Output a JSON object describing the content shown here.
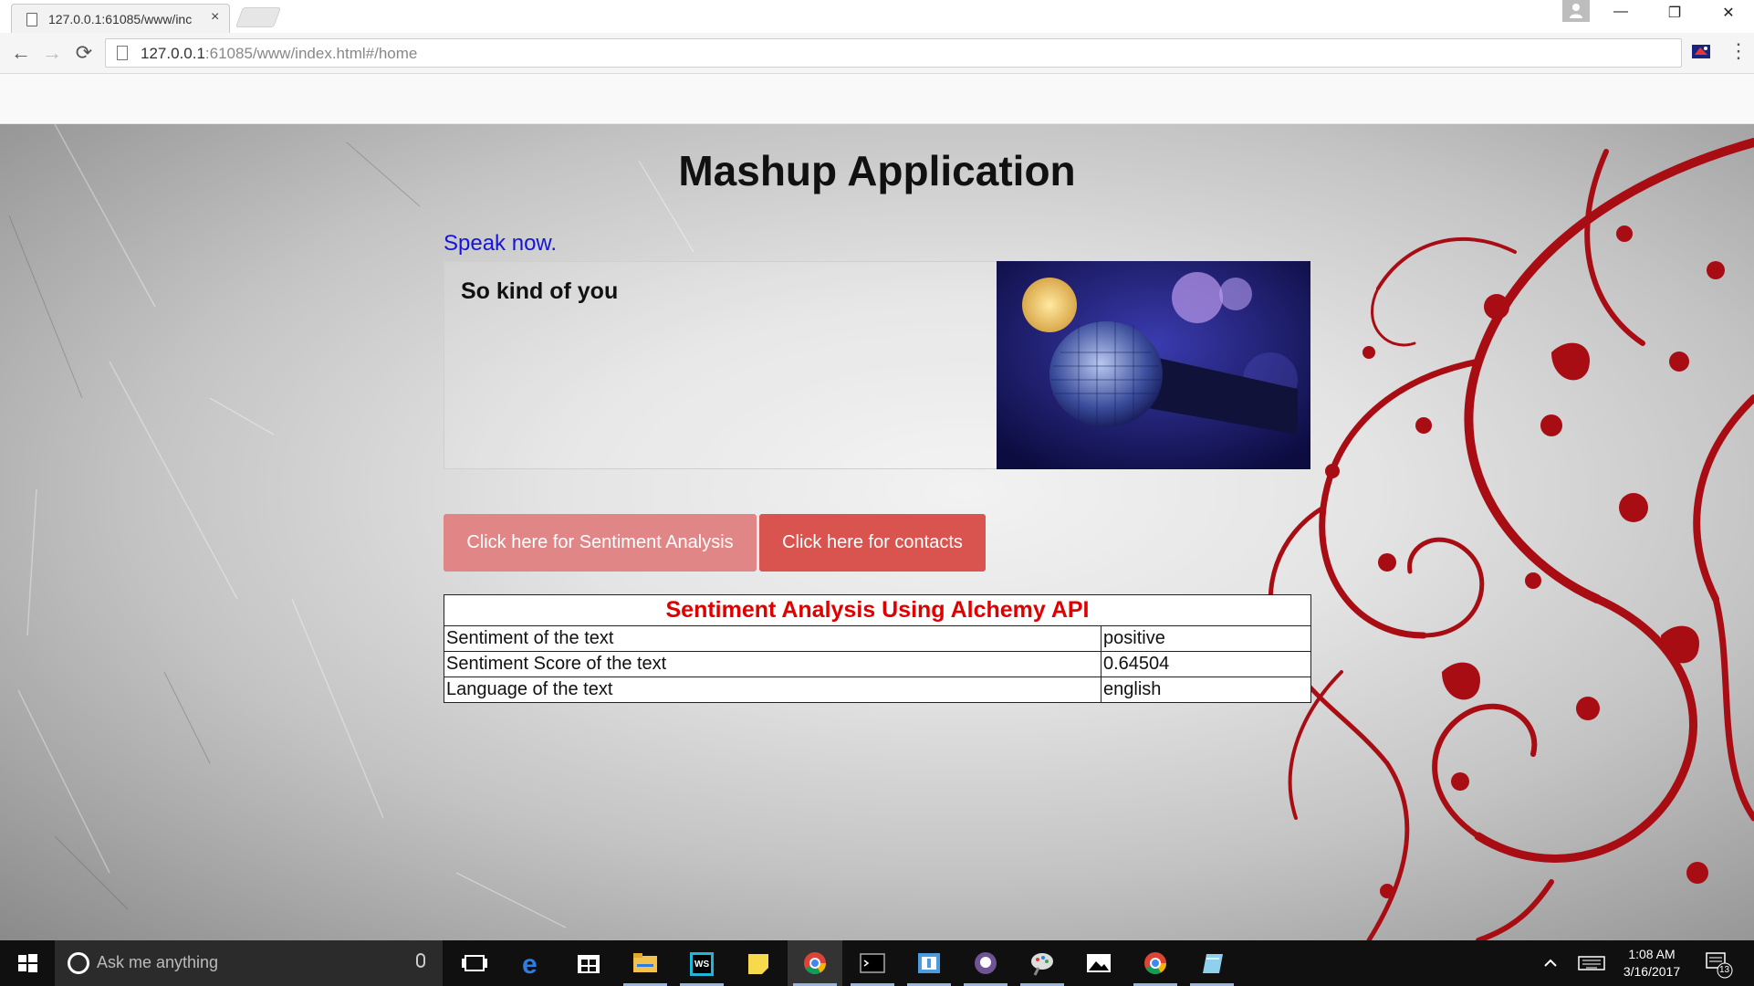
{
  "browser": {
    "tab_title": "127.0.0.1:61085/www/inc",
    "tab_close": "×",
    "url_host": "127.0.0.1",
    "url_rest": ":61085/www/index.html#/home",
    "back": "←",
    "forward": "→",
    "reload": "⟳",
    "menu": "⋮",
    "win_minimize": "—",
    "win_restore": "❐",
    "win_close": "✕"
  },
  "page": {
    "title": "Mashup Application",
    "speak_label": "Speak now.",
    "speech_text": "So kind of you",
    "buttons": {
      "sentiment": "Click here for Sentiment Analysis",
      "contacts": "Click here for contacts"
    },
    "table": {
      "heading": "Sentiment Analysis Using Alchemy API",
      "rows": [
        {
          "label": "Sentiment of the text",
          "value": "positive"
        },
        {
          "label": "Sentiment Score of the text",
          "value": "0.64504"
        },
        {
          "label": "Language of the text",
          "value": "english"
        }
      ]
    },
    "colors": {
      "heading_red": "#e00000",
      "speak_blue": "#1515d8",
      "button_light": "#e08686",
      "button_dark": "#d9534f"
    }
  },
  "taskbar": {
    "search_placeholder": "Ask me anything",
    "time": "1:08 AM",
    "date": "3/16/2017",
    "notification_count": "13",
    "apps": [
      "task-view-icon",
      "edge-icon",
      "store-icon",
      "file-explorer-icon",
      "webstorm-icon",
      "sticky-notes-icon",
      "chrome-icon",
      "terminal-icon",
      "app-icon",
      "github-icon",
      "paint-icon",
      "photos-icon",
      "chrome-icon",
      "notepad-icon"
    ]
  }
}
